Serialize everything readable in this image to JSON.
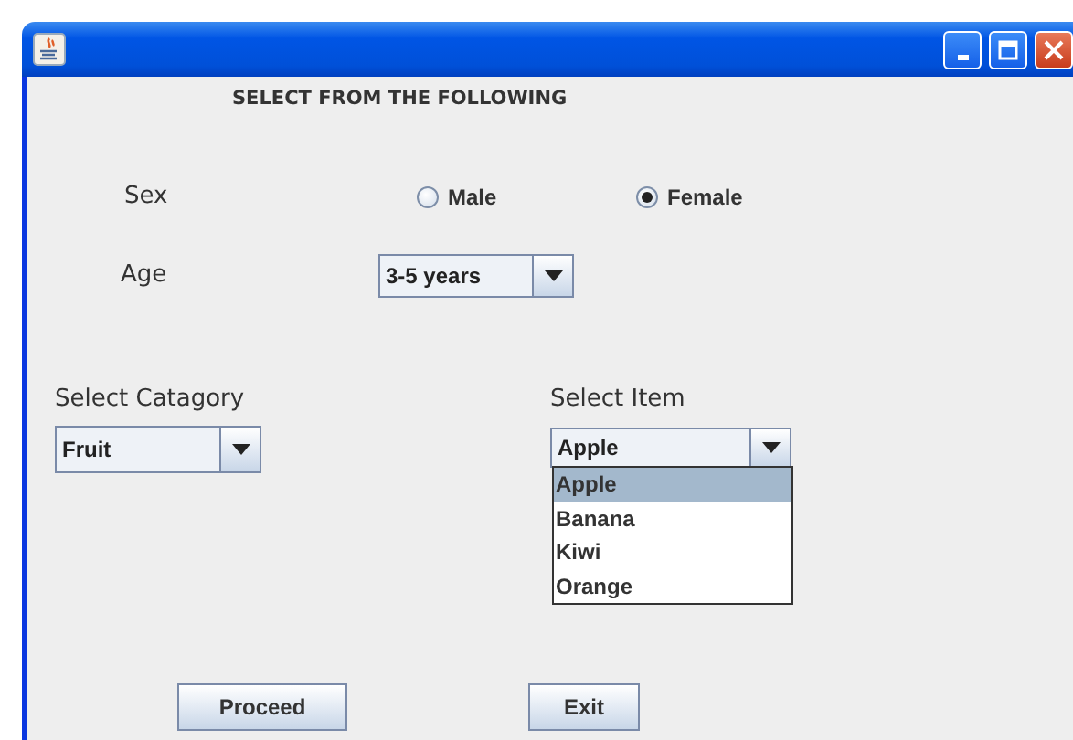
{
  "heading": "SELECT FROM THE FOLLOWING",
  "sex": {
    "label": "Sex",
    "options": [
      {
        "label": "Male",
        "selected": false
      },
      {
        "label": "Female",
        "selected": true
      }
    ]
  },
  "age": {
    "label": "Age",
    "value": "3-5 years"
  },
  "category": {
    "label": "Select Catagory",
    "value": "Fruit"
  },
  "item": {
    "label": "Select Item",
    "value": "Apple",
    "expanded": true,
    "options": [
      {
        "label": "Apple",
        "selected": true
      },
      {
        "label": "Banana",
        "selected": false
      },
      {
        "label": "Kiwi",
        "selected": false
      },
      {
        "label": "Orange",
        "selected": false
      }
    ]
  },
  "buttons": [
    "Proceed",
    "Exit"
  ]
}
